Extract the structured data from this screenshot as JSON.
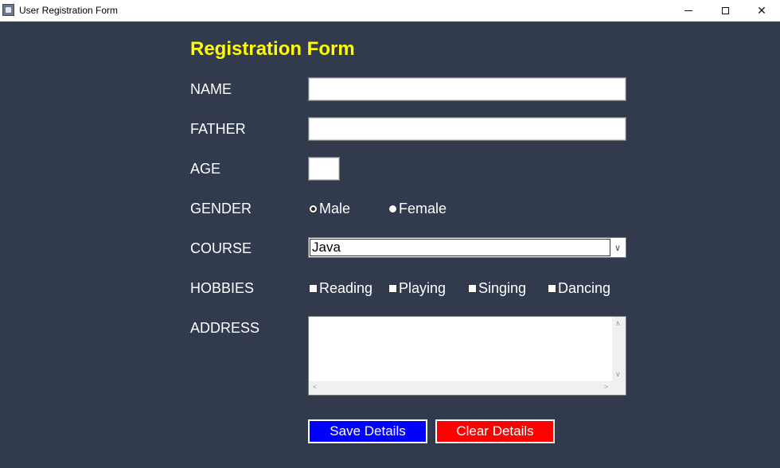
{
  "window": {
    "title": "User Registration Form",
    "controls": {
      "minimize": "minimize-icon",
      "maximize": "maximize-icon",
      "close": "✕"
    }
  },
  "form": {
    "heading": "Registration Form",
    "heading_color": "#ffff00",
    "background_color": "#323a4d",
    "labels": {
      "name": "NAME",
      "father": "FATHER",
      "age": "AGE",
      "gender": "GENDER",
      "course": "COURSE",
      "hobbies": "HOBBIES",
      "address": "ADDRESS"
    },
    "fields": {
      "name": "",
      "father": "",
      "age": "",
      "address": ""
    },
    "gender": {
      "options": [
        {
          "label": "Male",
          "selected": true
        },
        {
          "label": "Female",
          "selected": false
        }
      ]
    },
    "course": {
      "selected": "Java"
    },
    "hobbies": [
      {
        "label": "Reading",
        "checked": false
      },
      {
        "label": "Playing",
        "checked": false
      },
      {
        "label": "Singing",
        "checked": false
      },
      {
        "label": "Dancing",
        "checked": false
      }
    ],
    "buttons": {
      "save": {
        "label": "Save Details",
        "color": "#0000ff"
      },
      "clear": {
        "label": "Clear Details",
        "color": "#ff0000"
      }
    }
  }
}
